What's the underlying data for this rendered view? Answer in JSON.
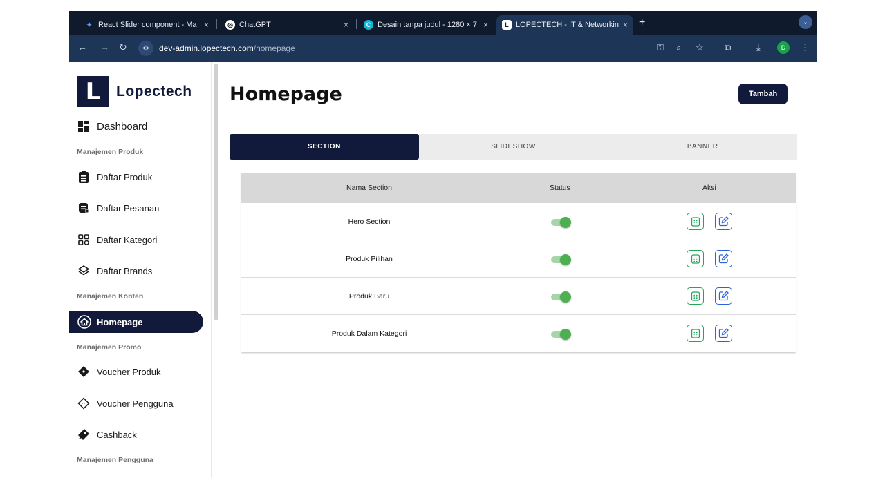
{
  "browser": {
    "tabs": [
      {
        "title": "React Slider component - Ma",
        "close": "×"
      },
      {
        "title": "ChatGPT",
        "close": "×"
      },
      {
        "title": "Desain tanpa judul - 1280 × 7",
        "close": "×"
      },
      {
        "title": "LOPECTECH - IT & Networkin",
        "close": "×"
      }
    ],
    "new_tab": "+",
    "url_host": "dev-admin.lopectech.com",
    "url_path": "/homepage",
    "profile_initial": "D"
  },
  "sidebar": {
    "logo_letter": "L",
    "brand": "Lopectech",
    "dashboard": "Dashboard",
    "sections": {
      "produk": "Manajemen Produk",
      "konten": "Manajemen Konten",
      "promo": "Manajemen Promo",
      "pengguna": "Manajemen Pengguna"
    },
    "items": {
      "daftar_produk": "Daftar Produk",
      "daftar_pesanan": "Daftar Pesanan",
      "daftar_kategori": "Daftar Kategori",
      "daftar_brands": "Daftar Brands",
      "homepage": "Homepage",
      "voucher_produk": "Voucher Produk",
      "voucher_pengguna": "Voucher Pengguna",
      "cashback": "Cashback"
    }
  },
  "main": {
    "title": "Homepage",
    "add_button": "Tambah",
    "tabs": [
      "SECTION",
      "SLIDESHOW",
      "BANNER"
    ],
    "table": {
      "headers": [
        "Nama Section",
        "Status",
        "Aksi"
      ],
      "rows": [
        {
          "name": "Hero Section",
          "active": true
        },
        {
          "name": "Produk Pilihan",
          "active": true
        },
        {
          "name": "Produk Baru",
          "active": true
        },
        {
          "name": "Produk Dalam Kategori",
          "active": true
        }
      ]
    }
  },
  "colors": {
    "primary": "#121a3b",
    "toggle_on": "#4caf50",
    "view_icon": "#22a55a",
    "edit_icon": "#2a64d6"
  }
}
